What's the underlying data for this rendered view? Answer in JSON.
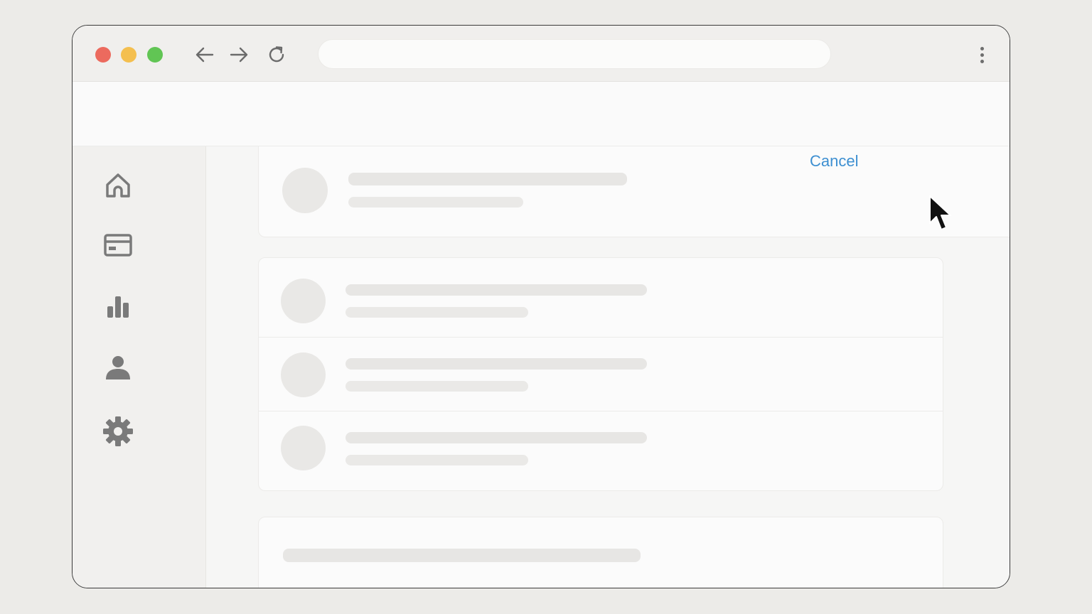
{
  "browser": {
    "address_value": "",
    "address_placeholder": "",
    "icons": {
      "back": "arrow-left-icon",
      "forward": "arrow-right-icon",
      "reload": "reload-icon",
      "menu": "more-vertical-icon"
    },
    "traffic_colors": {
      "close": "#ec6a5e",
      "minimize": "#f4bf4f",
      "maximize": "#61c554"
    }
  },
  "sidebar": {
    "items": [
      {
        "icon": "home-icon"
      },
      {
        "icon": "card-icon"
      },
      {
        "icon": "bar-chart-icon"
      },
      {
        "icon": "user-icon"
      },
      {
        "icon": "gear-icon"
      }
    ]
  },
  "main": {
    "top_card": {
      "action_label": "Cancel",
      "action_color": "#3d8fd1"
    },
    "list_card": {
      "row_count": 3
    }
  }
}
